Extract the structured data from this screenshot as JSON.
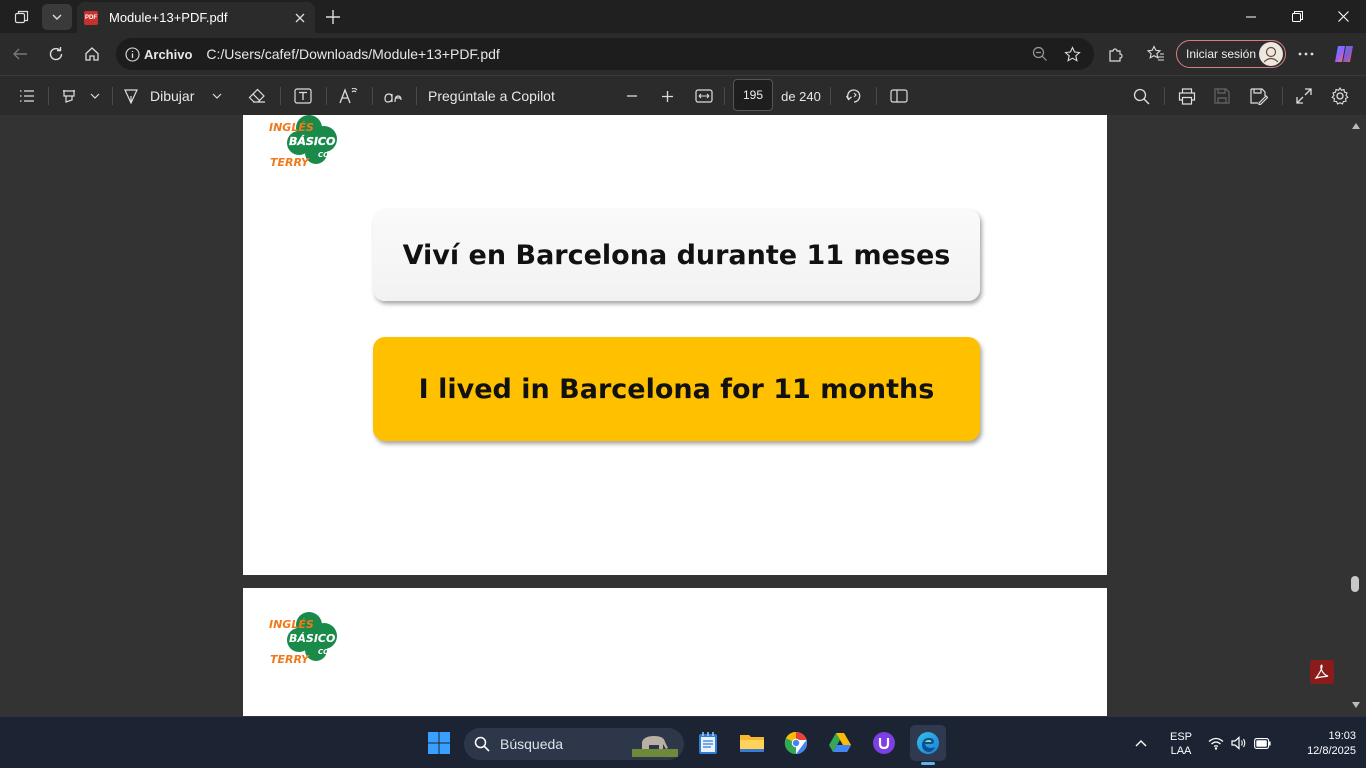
{
  "tab": {
    "favicon": "PDF",
    "title": "Module+13+PDF.pdf"
  },
  "address": {
    "site_label": "Archivo",
    "url": "C:/Users/cafef/Downloads/Module+13+PDF.pdf"
  },
  "profile": {
    "signin_label": "Iniciar sesión"
  },
  "pdf_toolbar": {
    "draw_label": "Dibujar",
    "copilot_label": "Pregúntale a Copilot",
    "page_current": "195",
    "page_total": "de 240"
  },
  "document": {
    "logo": {
      "line1": "INGLÉS",
      "line2": "BÁSICO",
      "line3": "CON",
      "line4": "TERRY"
    },
    "spanish_sentence": "Viví en Barcelona durante 11 meses",
    "english_sentence": "I lived in Barcelona for 11 months"
  },
  "taskbar": {
    "search_placeholder": "Búsqueda",
    "lang_top": "ESP",
    "lang_bottom": "LAA",
    "time": "19:03",
    "date": "12/8/2025"
  },
  "colors": {
    "accent_yellow": "#ffc000",
    "logo_green": "#1a8a4a",
    "logo_orange": "#f07a1a"
  }
}
